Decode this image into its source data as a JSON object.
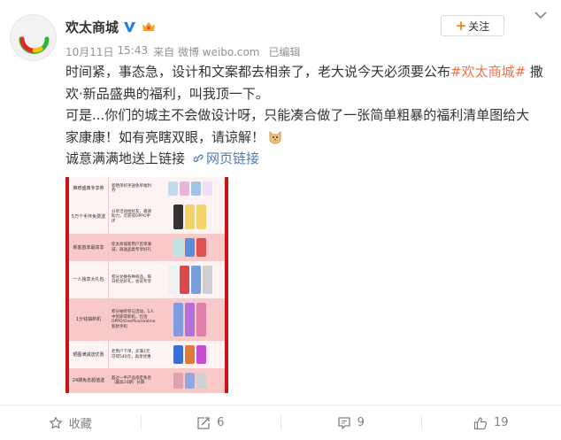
{
  "post": {
    "author": "欢太商城",
    "meta": {
      "date": "10月11日",
      "time": "15:43",
      "source": "来自 微博 weibo.com",
      "edited": "已编辑"
    },
    "follow_label": "关注",
    "text": {
      "l1a": "时间紧，事态急，设计和文案都去相亲了，老大说今天必须要公布",
      "hashtag": "#欢太商城#",
      "l1b": " 撒",
      "l2": "欢·新品盛典的福利，叫我顶一下。",
      "l3": "可是...你们的城主不会做设计呀，只能凑合做了一张简单粗暴的福利清单图给大",
      "l4": "家康康！如有亮瞎双眼，请谅解！",
      "l5a": "诚意满满地送上链接",
      "link_label": "网页链接"
    },
    "image_rows": [
      {
        "c1": "推荐盛典专享券",
        "c2": "新晒单好评送免单福利券",
        "bg": "white"
      },
      {
        "c1": "5万个手环免费送",
        "c2": "分享活动给好友，邀请助力，可获得OPPO手环",
        "bg": "white"
      },
      {
        "c1": "新客首单最高享",
        "c2": "欢太商城新用户首单满减，再送品类专享好礼",
        "bg": "pink"
      },
      {
        "c1": "一人独享大礼包",
        "c2": "积分兑换各种商品，每日抢兑好礼，会员专享",
        "bg": "white"
      },
      {
        "c1": "1分钱抽新机",
        "c2": "积分抽奖参与活动，1人中奖即得新机，包含OPPO/OnePlus/realme新款手机",
        "bg": "pink"
      },
      {
        "c1": "晒图满减送优惠",
        "c2": "老用户下单，买满1元可得540元，再享优惠",
        "bg": "white"
      },
      {
        "c1": "24期免息超值送",
        "c2": "超过一半产品指定免息（最高24期）分期",
        "bg": "pink"
      }
    ]
  },
  "actions": {
    "favorite": "收藏",
    "repost": "6",
    "comment": "9",
    "like": "19"
  },
  "colors": {
    "accent_orange": "#ff8200",
    "hashtag": "#eb7350",
    "link_blue": "#507daf",
    "image_red": "#c9151a"
  },
  "icons": [
    "verified-icon",
    "member-crown-icon",
    "chevron-down-icon",
    "cat-emoji-icon",
    "link-icon",
    "star-icon",
    "repost-icon",
    "comment-icon",
    "like-icon"
  ]
}
